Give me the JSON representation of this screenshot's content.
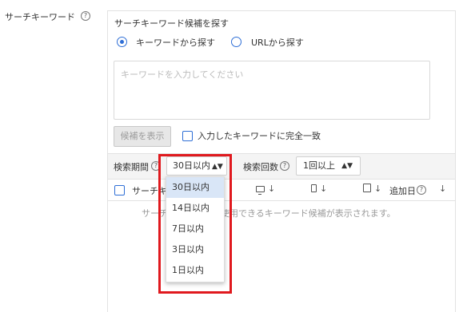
{
  "field": {
    "label": "サーチキーワード",
    "help": "?"
  },
  "panel": {
    "title": "サーチキーワード候補を探す"
  },
  "source_radio": {
    "options": [
      {
        "label": "キーワードから探す",
        "selected": true
      },
      {
        "label": "URLから探す",
        "selected": false
      }
    ]
  },
  "keyword_input": {
    "placeholder": "キーワードを入力してください",
    "value": ""
  },
  "show_candidates": {
    "label": "候補を表示",
    "enabled": false
  },
  "exact_match": {
    "label": "入力したキーワードに完全一致",
    "checked": false
  },
  "filters": {
    "period": {
      "label": "検索期間",
      "help": "?",
      "value": "30日以内",
      "arrows": "▲▼"
    },
    "count": {
      "label": "検索回数",
      "help": "?",
      "value": "1回以上",
      "arrows": "▲▼"
    }
  },
  "table": {
    "columns": {
      "search_word": "サーチキーワード",
      "added_date": "追加日",
      "added_help": "?",
      "sort_arrow": "↓",
      "more": "↓"
    },
    "empty_message": "サーチコンソールで使用できるキーワード候補が表示されます。"
  },
  "period_dropdown": {
    "open": true,
    "selected_index": 0,
    "options": [
      "30日以内",
      "14日以内",
      "7日以内",
      "3日以内",
      "1日以内"
    ]
  },
  "colors": {
    "accent": "#2f6fd6",
    "highlight_outline": "#e0191e",
    "selected_option_bg": "#d9e6f7"
  },
  "icons": [
    "help-circle-icon",
    "desktop-icon",
    "mobile-icon",
    "tablet-icon",
    "sort-down-icon",
    "up-down-arrows-icon"
  ]
}
